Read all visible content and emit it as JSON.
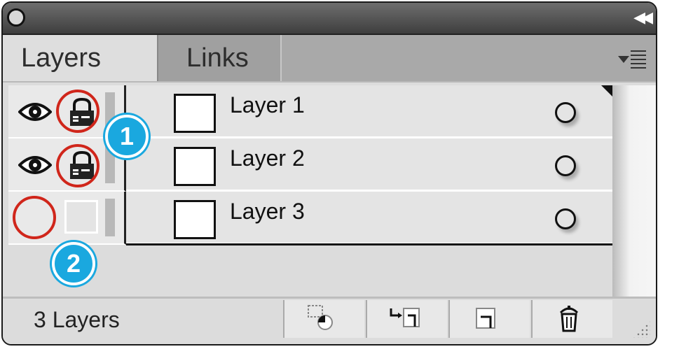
{
  "tabs": [
    {
      "label": "Layers"
    },
    {
      "label": "Links"
    }
  ],
  "layers": [
    {
      "name": "Layer 1",
      "visible": true,
      "locked": true
    },
    {
      "name": "Layer 2",
      "visible": true,
      "locked": true
    },
    {
      "name": "Layer 3",
      "visible": false,
      "locked": false
    }
  ],
  "footer": {
    "count_label": "3 Layers"
  },
  "callouts": [
    {
      "label": "1"
    },
    {
      "label": "2"
    }
  ],
  "colors": {
    "callout_ring": "#d0261b",
    "callout_badge": "#1aa8df"
  }
}
